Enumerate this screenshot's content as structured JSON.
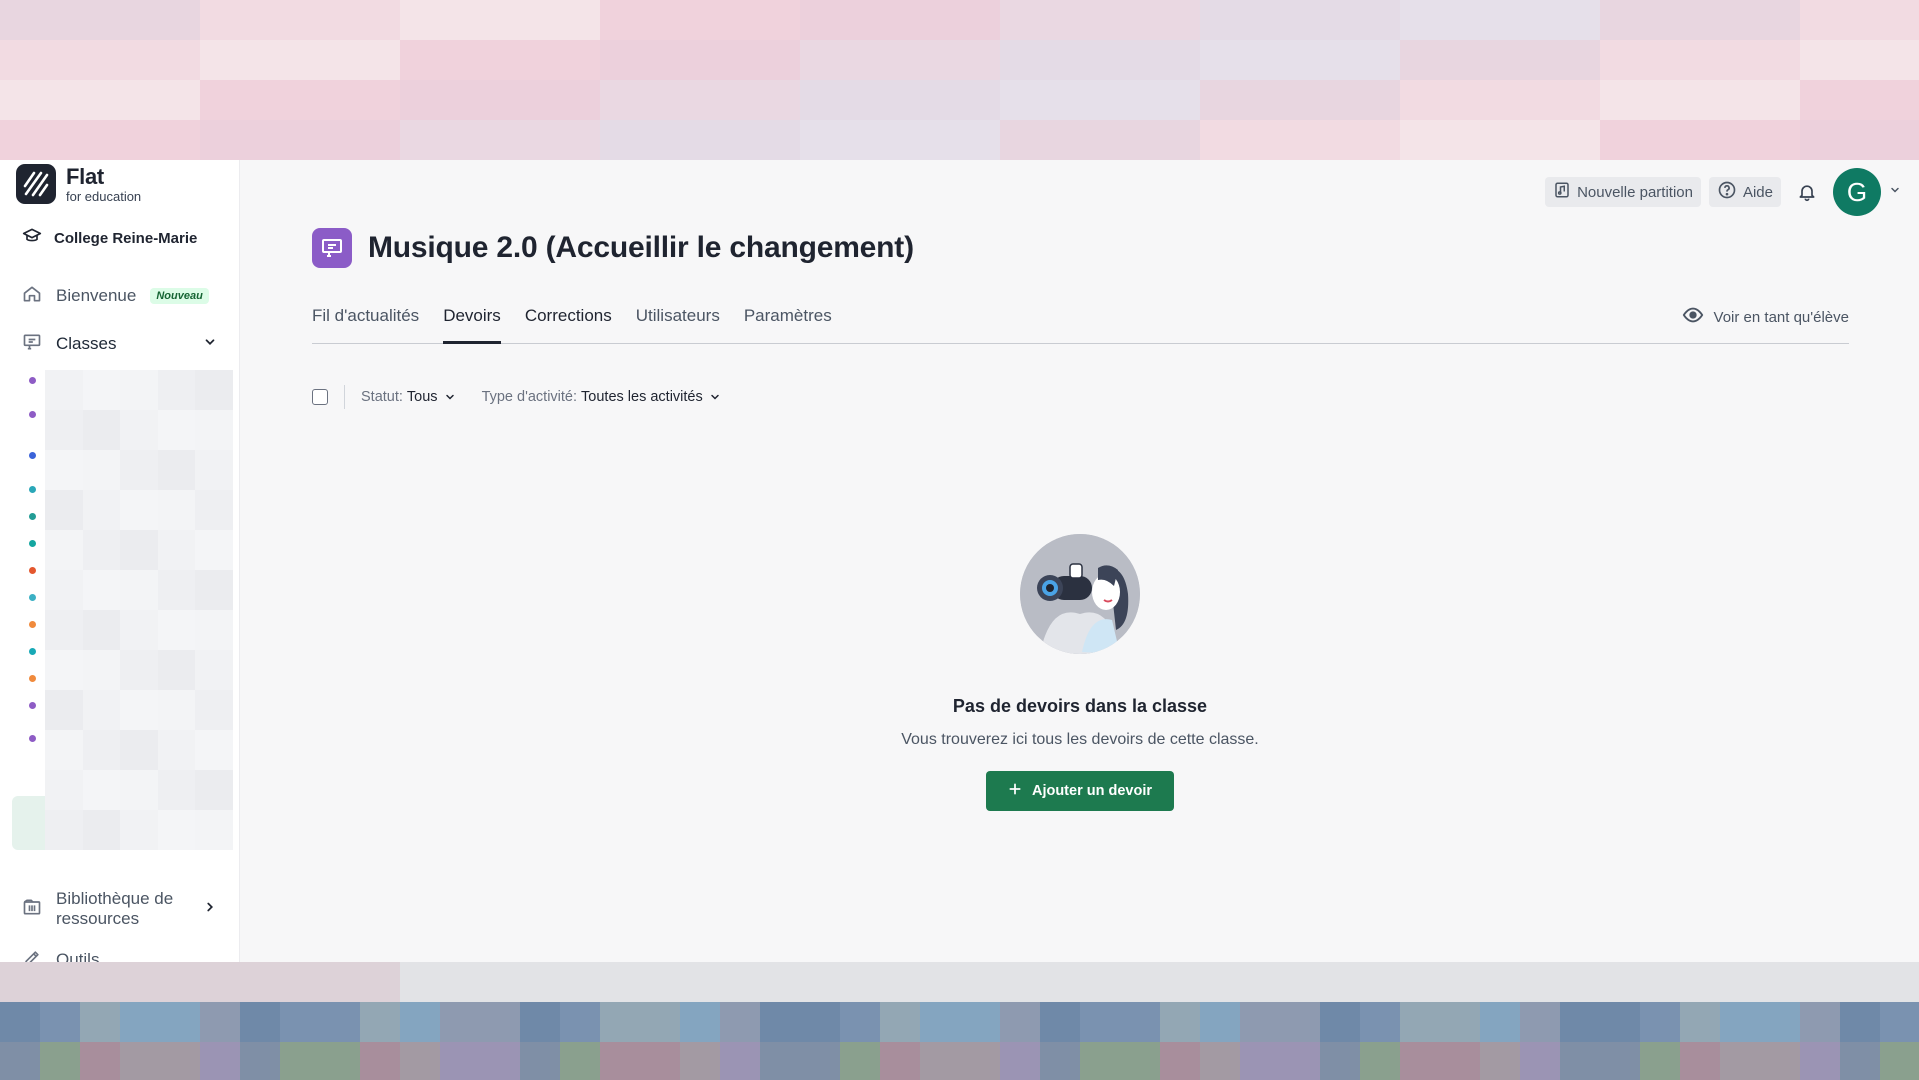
{
  "brand": {
    "name": "Flat",
    "subtitle": "for education"
  },
  "sidebar": {
    "organization": "College Reine-Marie",
    "items": [
      {
        "label": "Bienvenue",
        "badge": "Nouveau",
        "icon": "home-icon"
      },
      {
        "label": "Classes",
        "icon": "classes-icon"
      },
      {
        "label": "Bibliothèque de ressources",
        "icon": "library-icon"
      },
      {
        "label": "Outils",
        "icon": "tools-icon"
      }
    ],
    "class_dot_colors": [
      "#8e5cc5",
      "#8e5cc5",
      "#3b63d9",
      "#2aa7b8",
      "#229c95",
      "#14a6a0",
      "#e4572e",
      "#3bb0c4",
      "#f08a3c",
      "#17a9b6",
      "#f08a3c",
      "#8e5cc5",
      "#8e5cc5"
    ]
  },
  "topbar": {
    "new_score": "Nouvelle partition",
    "help": "Aide",
    "avatar_letter": "G"
  },
  "class": {
    "title": "Musique 2.0 (Accueillir le changement)",
    "accent": "#8b5cc7"
  },
  "tabs": [
    {
      "label": "Fil d'actualités"
    },
    {
      "label": "Devoirs",
      "active": true
    },
    {
      "label": "Corrections"
    },
    {
      "label": "Utilisateurs"
    },
    {
      "label": "Paramètres"
    }
  ],
  "view_as_student": "Voir en tant qu'élève",
  "filters": {
    "status_label": "Statut:",
    "status_value": "Tous",
    "type_label": "Type d'activité:",
    "type_value": "Toutes les activités"
  },
  "empty_state": {
    "title": "Pas de devoirs dans la classe",
    "subtitle": "Vous trouverez ici tous les devoirs de cette classe.",
    "button": "Ajouter un devoir",
    "button_color": "#1d7a4f"
  }
}
